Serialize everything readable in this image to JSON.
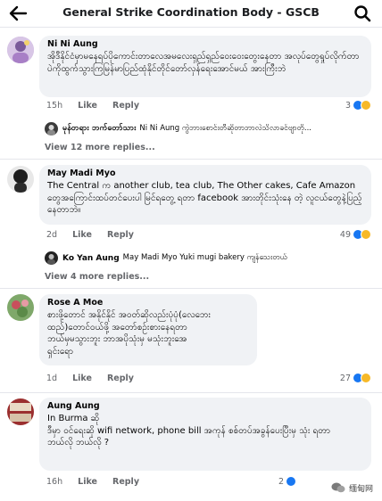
{
  "header": {
    "title": "General Strike Coordination Body - GSCB",
    "back_icon": "arrow-left-icon",
    "search_icon": "search-icon"
  },
  "colors": {
    "meta": "#65676b",
    "bubble": "#f0f2f5",
    "like": "#1877f2",
    "haha": "#f7b928"
  },
  "comments": [
    {
      "author": "Ni Ni Aung",
      "text": "အိုဒီနိုင်ငံမှာမနေရပ်ပိုကောင်းတာလေအမလေးရှည်ရှည်ဝေးဝေးတွေးနေတာ အလုပ်တွေရှုပ်လိုက်တာပဲကိုထွက်သွားကြမြန်မာပြည်ထုံနိုင်တိုင်တော်လှန်ရေးအောင်မယ် အားကြီးဘဲ",
      "time": "15h",
      "like": "Like",
      "reply": "Reply",
      "reaction_count": "3",
      "reply_preview": {
        "author": "မုန်တရား ဘက်တော်သား",
        "text": "Ni Ni Aung ကွဲဘားစောင်းတီဆိုတာဘာလဲသိလာခင်ဗျာတို..."
      },
      "view_more": "View 12 more replies..."
    },
    {
      "author": "May Madi Myo",
      "text": "The Central က another club, tea club, The Other cakes, Cafe Amazon တွေအကြောင်းထပ်တင်ပေးပါ မြင်ရတွေ့ ရတာ facebook အားတိုင်းသုံးနေ တဲ့ လူငယ်တွေနဲ့ပြည့်နေတာဘဲ။",
      "time": "2d",
      "like": "Like",
      "reply": "Reply",
      "reaction_count": "49",
      "reply_preview": {
        "author": "Ko Yan Aung",
        "text": "May Madi Myo Yuki mugi bakery ကျန်သေးတယ်"
      },
      "view_more": "View 4 more replies..."
    },
    {
      "author": "Rose A Moe",
      "text": "စားဖို့တောင် အနိုင်နိုင် အဝတ်ဆိုလည်းပုံပုံ(လေဘေးထည်)တောင်ဝယ်ဖို့ အတော်စဉ်းစားနေရတာ\nဘယ်မှမသွားဘူး ဘာအပိုသုံးမှ မသုံးဘူးအေ\nရှင်းရော",
      "time": "1d",
      "like": "Like",
      "reply": "Reply",
      "reaction_count": "27"
    },
    {
      "author": "Aung Aung",
      "text": "In Burma ဆို\nဒီမှာ ဝင်ရေးဆို wifi network, phone bill အကုန် စစ်တပ်အခွန်ပေးပြီးမှ သုံး ရတာ\nဘယ်လို ဘယ်လို ?",
      "time": "16h",
      "like": "Like",
      "reply": "Reply",
      "reaction_count": "2"
    }
  ],
  "watermark": "缅甸网"
}
